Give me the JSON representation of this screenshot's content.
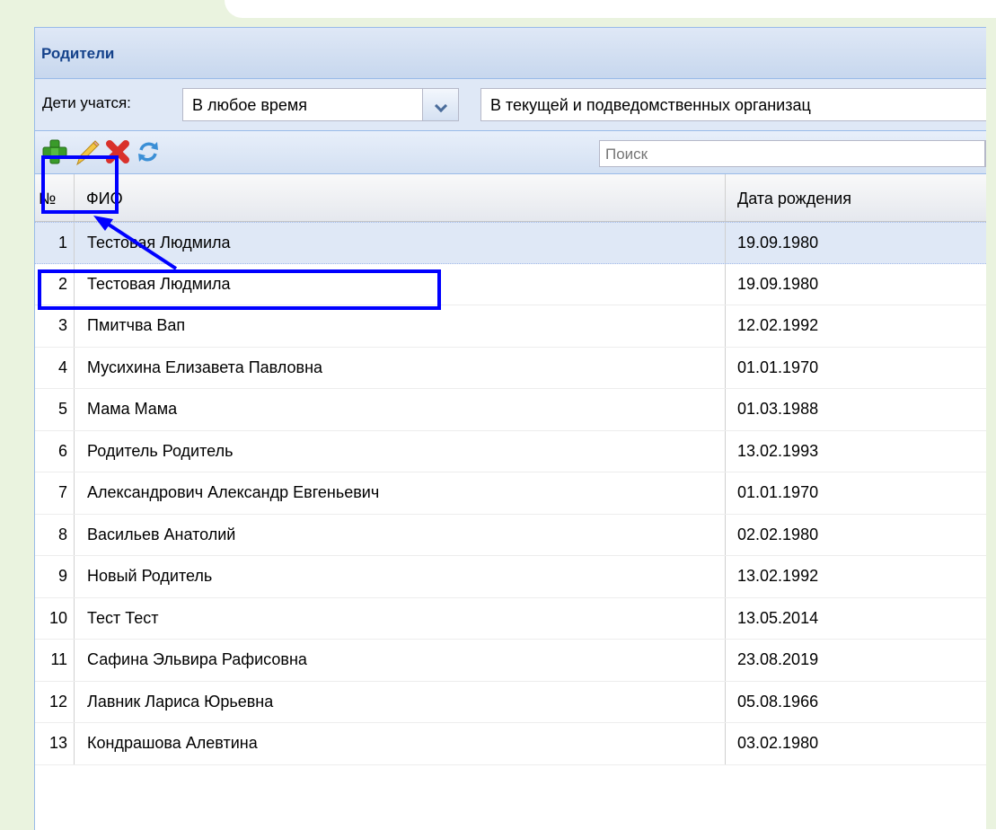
{
  "panel": {
    "title": "Родители"
  },
  "filters": {
    "label": "Дети учатся:",
    "period_value": "В любое время",
    "scope_value": "В текущей и подведомственных организац"
  },
  "toolbar": {
    "search_placeholder": "Поиск"
  },
  "grid": {
    "headers": {
      "num": "№",
      "name": "ФИО",
      "birth": "Дата рождения"
    },
    "rows": [
      {
        "num": "1",
        "name": "Тестовая Людмила",
        "birth": "19.09.1980"
      },
      {
        "num": "2",
        "name": "Тестовая Людмила",
        "birth": "19.09.1980"
      },
      {
        "num": "3",
        "name": "Пмитчва Вап",
        "birth": "12.02.1992"
      },
      {
        "num": "4",
        "name": "Мусихина Елизавета Павловна",
        "birth": "01.01.1970"
      },
      {
        "num": "5",
        "name": "Мама Мама",
        "birth": "01.03.1988"
      },
      {
        "num": "6",
        "name": "Родитель Родитель",
        "birth": "13.02.1993"
      },
      {
        "num": "7",
        "name": "Александрович Александр Евгеньевич",
        "birth": "01.01.1970"
      },
      {
        "num": "8",
        "name": "Васильев Анатолий",
        "birth": "02.02.1980"
      },
      {
        "num": "9",
        "name": "Новый Родитель",
        "birth": "13.02.1992"
      },
      {
        "num": "10",
        "name": "Тест Тест",
        "birth": "13.05.2014"
      },
      {
        "num": "11",
        "name": "Сафина Эльвира Рафисовна",
        "birth": "23.08.2019"
      },
      {
        "num": "12",
        "name": "Лавник Лариса Юрьевна",
        "birth": "05.08.1966"
      },
      {
        "num": "13",
        "name": "Кондрашова Алевтина",
        "birth": "03.02.1980"
      }
    ]
  },
  "colors": {
    "annotation": "#0000ff",
    "header_text": "#15428b",
    "selected_row": "#dfe8f6"
  }
}
